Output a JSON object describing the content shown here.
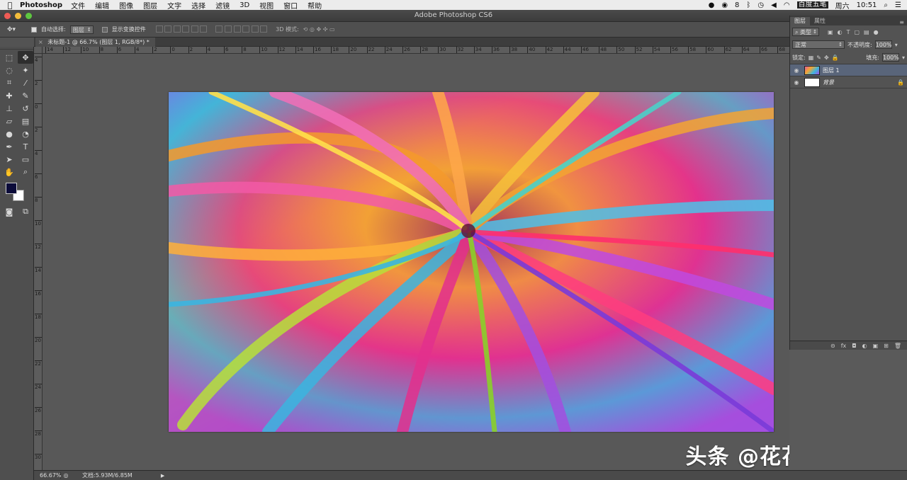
{
  "menubar": {
    "apple": "",
    "app_name": "Photoshop",
    "items": [
      "文件",
      "编辑",
      "图像",
      "图层",
      "文字",
      "选择",
      "滤镜",
      "3D",
      "视图",
      "窗口",
      "帮助"
    ],
    "tray_badge": "8",
    "ime": "百度五笔",
    "day": "周六",
    "time": "10:51"
  },
  "window": {
    "title": "Adobe Photoshop CS6"
  },
  "options": {
    "auto_select_label": "自动选择:",
    "auto_select_value": "图层",
    "show_transform_label": "显示变换控件",
    "mode_3d_label": "3D 模式:"
  },
  "document": {
    "tab_label": "未标题-1 @ 66.7% (图层 1, RGB/8*) *",
    "close_glyph": "×"
  },
  "rulers": {
    "h_ticks": [
      "14",
      "12",
      "10",
      "8",
      "6",
      "4",
      "2",
      "0",
      "2",
      "4",
      "6",
      "8",
      "10",
      "12",
      "14",
      "16",
      "18",
      "20",
      "22",
      "24",
      "26",
      "28",
      "30",
      "32",
      "34",
      "36",
      "38",
      "40",
      "42",
      "44",
      "46",
      "48",
      "50",
      "52",
      "54",
      "56",
      "58",
      "60",
      "62",
      "64",
      "66",
      "68"
    ],
    "v_ticks": [
      "4",
      "2",
      "0",
      "2",
      "4",
      "6",
      "8",
      "1​0",
      "1​2",
      "1​4",
      "1​6",
      "1​8",
      "2​0",
      "2​2",
      "2​4",
      "2​6",
      "2​8",
      "3​0"
    ]
  },
  "toolbox": {
    "tools": [
      {
        "name": "marquee-tool",
        "glyph": "⬚"
      },
      {
        "name": "move-tool",
        "glyph": "✥"
      },
      {
        "name": "lasso-tool",
        "glyph": "◌"
      },
      {
        "name": "quick-select-tool",
        "glyph": "✦"
      },
      {
        "name": "crop-tool",
        "glyph": "⌗"
      },
      {
        "name": "eyedropper-tool",
        "glyph": "⁄"
      },
      {
        "name": "healing-brush-tool",
        "glyph": "✚"
      },
      {
        "name": "brush-tool",
        "glyph": "✎"
      },
      {
        "name": "clone-stamp-tool",
        "glyph": "⊥"
      },
      {
        "name": "history-brush-tool",
        "glyph": "↺"
      },
      {
        "name": "eraser-tool",
        "glyph": "▱"
      },
      {
        "name": "gradient-tool",
        "glyph": "▤"
      },
      {
        "name": "blur-tool",
        "glyph": "●"
      },
      {
        "name": "dodge-tool",
        "glyph": "◔"
      },
      {
        "name": "pen-tool",
        "glyph": "✒"
      },
      {
        "name": "type-tool",
        "glyph": "T"
      },
      {
        "name": "path-select-tool",
        "glyph": "➤"
      },
      {
        "name": "shape-tool",
        "glyph": "▭"
      },
      {
        "name": "hand-tool",
        "glyph": "✋"
      },
      {
        "name": "zoom-tool",
        "glyph": "⌕"
      }
    ],
    "foreground_color": "#0c0c3a",
    "background_color": "#ffffff",
    "bottom_tools": [
      {
        "name": "quick-mask-tool",
        "glyph": "◙"
      },
      {
        "name": "screen-mode-tool",
        "glyph": "⧉"
      }
    ]
  },
  "canvas": {
    "artwork_description_colors": [
      "#f3a532",
      "#e3308d",
      "#3bb5e0",
      "#a34fe0",
      "#b8e03a",
      "#f06a2a"
    ]
  },
  "watermark": {
    "text": "头条 @花花平面设计"
  },
  "status": {
    "zoom": "66.67%",
    "doc": "文档:5.93M/6.85M",
    "arrow": "▶"
  },
  "layers_panel": {
    "tabs": [
      "图层",
      "属性"
    ],
    "menu_glyph": "≡",
    "filter_label": "类型",
    "blend_mode": "正常",
    "opacity_label": "不透明度:",
    "opacity_value": "100%",
    "lock_label": "锁定:",
    "fill_label": "填充:",
    "fill_value": "100%",
    "layers": [
      {
        "name": "图层 1",
        "selected": true,
        "thumb": "art",
        "locked": false
      },
      {
        "name": "背景",
        "selected": false,
        "thumb": "white",
        "locked": true
      }
    ],
    "bottom_icons": [
      "⊝",
      "fx",
      "◘",
      "◐",
      "▣",
      "⊞",
      "🗑"
    ]
  }
}
